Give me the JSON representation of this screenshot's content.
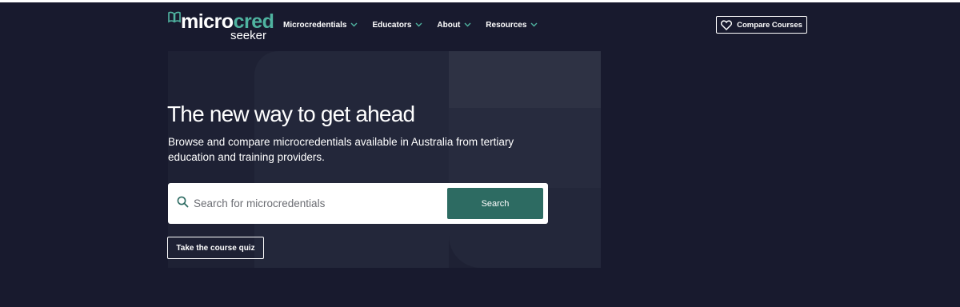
{
  "logo": {
    "word_main": "micro",
    "word_accent": "cred",
    "word_sub": "seeker",
    "icon": "book-icon",
    "accent_color": "#4fb3a0"
  },
  "nav": {
    "items": [
      {
        "label": "Microcredentials",
        "icon": "chevron-down-icon"
      },
      {
        "label": "Educators",
        "icon": "chevron-down-icon"
      },
      {
        "label": "About",
        "icon": "chevron-down-icon"
      },
      {
        "label": "Resources",
        "icon": "chevron-down-icon"
      }
    ],
    "compare_label": "Compare Courses",
    "compare_icon": "heart-icon"
  },
  "hero": {
    "title": "The new way to get ahead",
    "subtitle": "Browse and compare microcredentials available in Australia from tertiary education and training providers.",
    "background_color": "#181a2e"
  },
  "search": {
    "placeholder": "Search for microcredentials",
    "value": "",
    "button_label": "Search",
    "button_color": "#2d6b62"
  },
  "quiz": {
    "label": "Take the course quiz"
  }
}
